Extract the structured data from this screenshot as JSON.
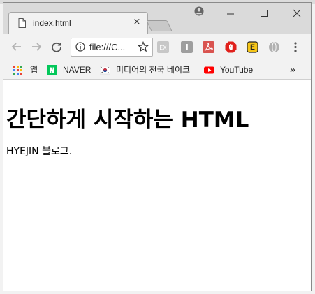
{
  "window": {
    "tab_title": "index.html",
    "close_glyph": "×"
  },
  "omnibox": {
    "url_display": "file:///C..."
  },
  "bookmarks": [
    {
      "label": "앱",
      "icon": "apps-grid-icon"
    },
    {
      "label": "NAVER",
      "icon": "naver-icon"
    },
    {
      "label": "미디어의 천국 베이크",
      "icon": "korea-flag-icon"
    },
    {
      "label": "YouTube",
      "icon": "youtube-icon"
    }
  ],
  "bookmarks_overflow": "»",
  "page": {
    "heading": "간단하게 시작하는 HTML",
    "paragraph": "HYEJIN 블로그."
  },
  "colors": {
    "titlebar": "#dadada",
    "toolbar": "#f2f2f2",
    "naver_green": "#03c75a",
    "youtube_red": "#ff0000"
  }
}
